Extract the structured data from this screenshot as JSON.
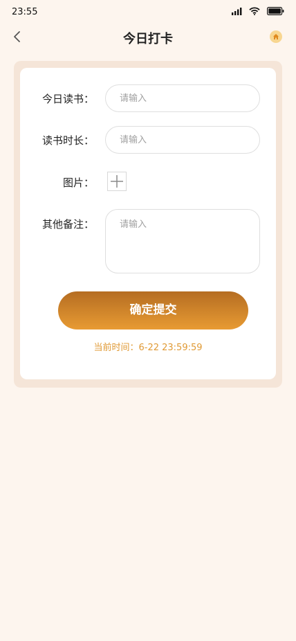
{
  "status_bar": {
    "time": "23:55"
  },
  "nav": {
    "title": "今日打卡"
  },
  "form": {
    "reading_label": "今日读书：",
    "reading_placeholder": "请输入",
    "duration_label": "读书时长：",
    "duration_placeholder": "请输入",
    "image_label": "图片：",
    "notes_label": "其他备注：",
    "notes_placeholder": "请输入"
  },
  "submit": {
    "label": "确定提交"
  },
  "current_time": {
    "label": "当前时间：",
    "value": "6-22 23:59:59"
  },
  "colors": {
    "background": "#fdf5ee",
    "accent": "#e09a35",
    "button_top": "#b56d22",
    "button_bottom": "#e89b33"
  },
  "icons": {
    "back": "chevron-left-icon",
    "home": "home-icon",
    "add": "plus-icon"
  }
}
